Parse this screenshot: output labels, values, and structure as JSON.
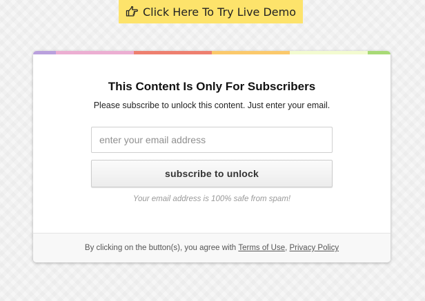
{
  "demo_button": {
    "label": "Click Here To Try Live Demo",
    "icon": "hand-pointing-right-icon",
    "background": "#fde36b"
  },
  "card": {
    "stripe_colors": [
      "#b9a0dd",
      "#ecaed2",
      "#ee7f6f",
      "#fbc96b",
      "#f3fbd0",
      "#a8da76"
    ],
    "title": "This Content Is Only For Subscribers",
    "subtitle": "Please subscribe to unlock this content. Just enter your email.",
    "email_field": {
      "placeholder": "enter your email address",
      "value": ""
    },
    "subscribe_label": "subscribe to unlock",
    "safe_note": "Your email address is 100% safe from spam!",
    "footer": {
      "prefix": "By clicking on the button(s), you agree with ",
      "terms_link": "Terms of Use",
      "separator": ", ",
      "privacy_link": "Privacy Policy"
    }
  }
}
